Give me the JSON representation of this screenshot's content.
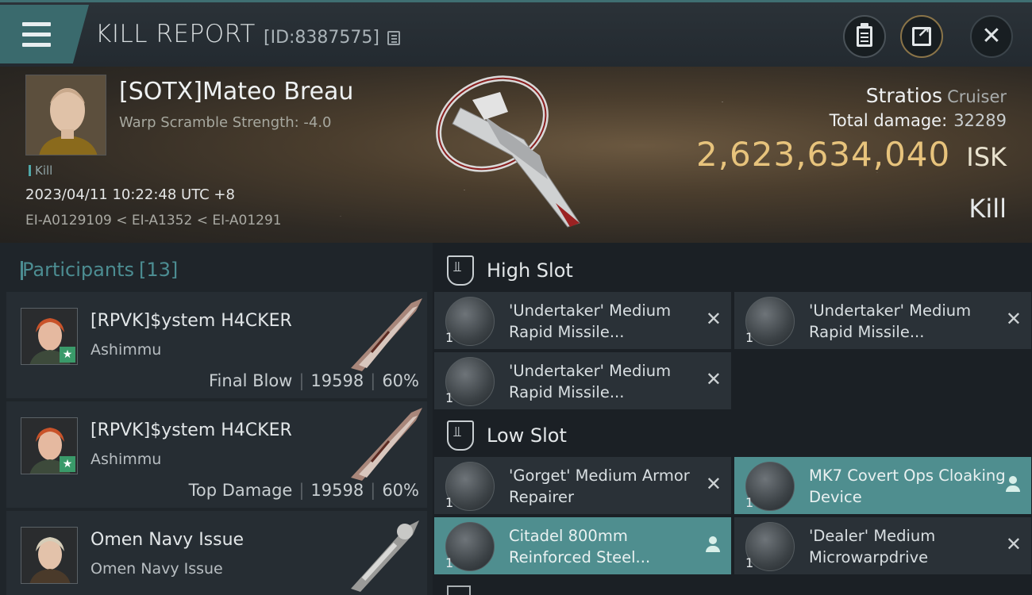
{
  "header": {
    "title": "KILL REPORT",
    "report_id": "[ID:8387575]"
  },
  "victim": {
    "name": "[SOTX]Mateo Breau",
    "subtitle": "Warp Scramble Strength: -4.0",
    "tag": "Kill",
    "timestamp": "2023/04/11 10:22:48 UTC +8",
    "location": "EI-A0129109 < EI-A1352 < EI-A01291",
    "ship_name": "Stratios",
    "ship_class": "Cruiser",
    "damage_label": "Total damage:",
    "damage_value": "32289",
    "isk_value": "2,623,634,040",
    "isk_unit": "ISK",
    "result": "Kill"
  },
  "participants": {
    "label": "Participants",
    "count": "[13]",
    "items": [
      {
        "name": "[RPVK]$ystem H4CKER",
        "ship": "Ashimmu",
        "role": "Final Blow",
        "damage": "19598",
        "percent": "60%"
      },
      {
        "name": "[RPVK]$ystem H4CKER",
        "ship": "Ashimmu",
        "role": "Top Damage",
        "damage": "19598",
        "percent": "60%"
      },
      {
        "name": "Omen Navy Issue",
        "ship": "Omen Navy Issue",
        "role": "",
        "damage": "",
        "percent": ""
      }
    ]
  },
  "slots": {
    "high_title": "High Slot",
    "low_title": "Low Slot",
    "high": [
      {
        "name": "'Undertaker' Medium Rapid Missile...",
        "qty": "1",
        "status": "destroyed"
      },
      {
        "name": "'Undertaker' Medium Rapid Missile...",
        "qty": "1",
        "status": "destroyed"
      },
      {
        "name": "'Undertaker' Medium Rapid Missile...",
        "qty": "1",
        "status": "destroyed"
      }
    ],
    "low": [
      {
        "name": "'Gorget' Medium Armor Repairer",
        "qty": "1",
        "status": "destroyed"
      },
      {
        "name": "MK7 Covert Ops Cloaking Device",
        "qty": "1",
        "status": "dropped"
      },
      {
        "name": "Citadel 800mm Reinforced Steel...",
        "qty": "1",
        "status": "dropped"
      },
      {
        "name": "'Dealer' Medium Microwarpdrive",
        "qty": "1",
        "status": "destroyed"
      }
    ]
  },
  "colors": {
    "accent_teal": "#4f8e8f",
    "isk_gold": "#e7c37c"
  }
}
